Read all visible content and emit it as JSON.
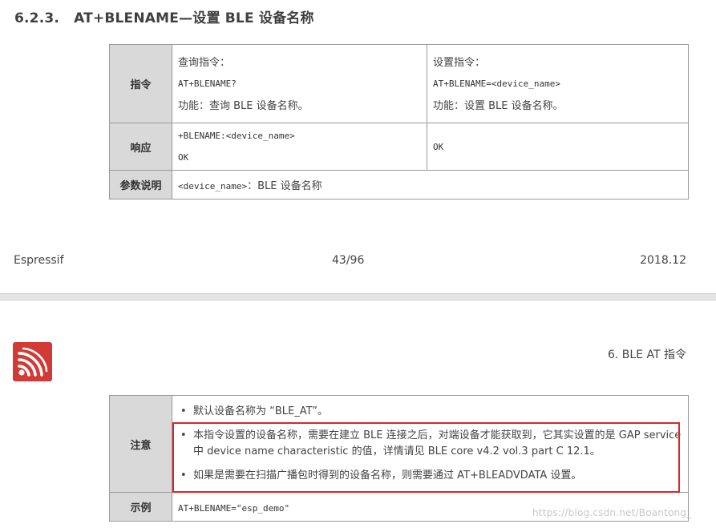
{
  "section": {
    "number": "6.2.3.",
    "title": "AT+BLENAME—设置 BLE 设备名称"
  },
  "table1": {
    "row_cmd": {
      "label": "指令",
      "query_title": "查询指令：",
      "query_cmd": "AT+BLENAME?",
      "query_desc": "功能：查询 BLE 设备名称。",
      "set_title": "设置指令：",
      "set_cmd": "AT+BLENAME=<device_name>",
      "set_desc": "功能：设置 BLE 设备名称。"
    },
    "row_resp": {
      "label": "响应",
      "query_resp_line1": "+BLENAME:<device_name>",
      "query_resp_line2": "OK",
      "set_resp": "OK"
    },
    "row_param": {
      "label": "参数说明",
      "param_name": "<device_name>",
      "param_desc": "：BLE 设备名称"
    }
  },
  "footer": {
    "company": "Espressif",
    "page": "43/96",
    "date": "2018.12"
  },
  "page2": {
    "chapter": "6. BLE AT 指令"
  },
  "table2": {
    "row_note": {
      "label": "注意",
      "bullet": "•",
      "note1": "默认设备名称为 “BLE_AT”。",
      "note2": "本指令设置的设备名称，需要在建立 BLE 连接之后，对端设备才能获取到，它其实设置的是 GAP service 中 device name characteristic 的值，详情请见 BLE core v4.2 vol.3 part C 12.1。",
      "note3": "如果是需要在扫描广播包时得到的设备名称，则需要通过 AT+BLEADVDATA 设置。"
    },
    "row_example": {
      "label": "示例",
      "example": "AT+BLENAME=\"esp_demo\""
    }
  },
  "watermark": "https://blog.csdn.net/Boantong_",
  "colors": {
    "label_bg": "#d9d9d9",
    "highlight": "#e2232a",
    "logo": "#d23a35"
  }
}
